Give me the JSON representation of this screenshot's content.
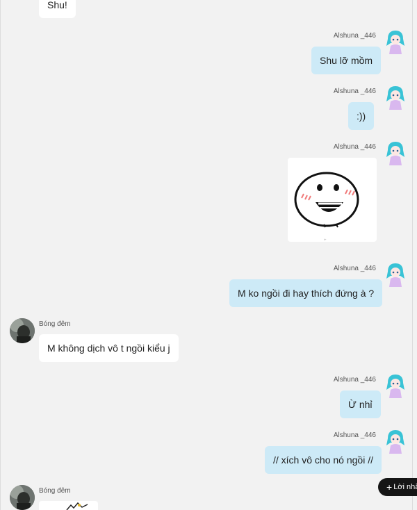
{
  "messages": [
    {
      "side": "left",
      "text": "Shu!"
    },
    {
      "side": "right",
      "sender": "Alshuna _446",
      "text": "Shu lỡ mồm"
    },
    {
      "side": "right",
      "sender": "Alshuna _446",
      "text": ":))"
    },
    {
      "side": "right",
      "sender": "Alshuna _446",
      "image": "smiley-sticker"
    },
    {
      "side": "right",
      "sender": "Alshuna _446",
      "text": "M ko ngồi đi hay thích đứng à ?"
    },
    {
      "side": "left",
      "sender": "Bóng đêm",
      "text": "M không dịch vô t ngồi kiểu j"
    },
    {
      "side": "right",
      "sender": "Alshuna _446",
      "text": "Ừ nhỉ"
    },
    {
      "side": "right",
      "sender": "Alshuna _446",
      "text": "// xích vô cho nó ngồi //"
    },
    {
      "side": "left",
      "sender": "Bóng đêm",
      "image": "partial-image"
    }
  ],
  "reply_button": {
    "icon": "plus-icon",
    "label": "Lời nhắn"
  },
  "colors": {
    "outgoing_bubble": "#cdeaf7",
    "incoming_bubble": "#ffffff",
    "background": "#f2f2f2",
    "reply_button": "#151515"
  }
}
